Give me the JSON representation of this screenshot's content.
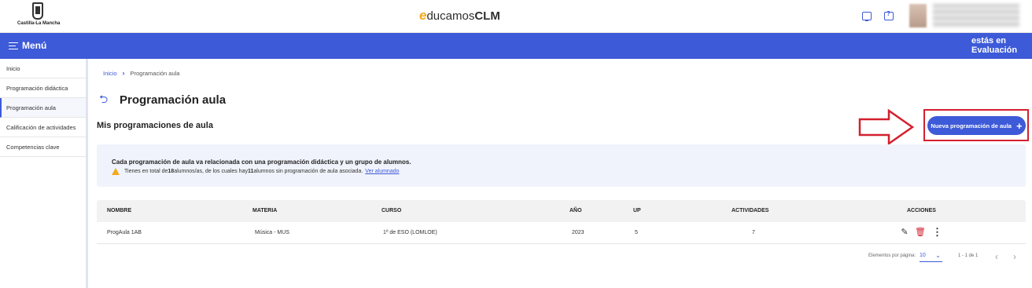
{
  "header": {
    "org_logo_text": "Castilla-La Mancha",
    "brand": {
      "e": "e",
      "ducamos": "ducamos",
      "clm": "CLM"
    },
    "icons": [
      "monitor-icon",
      "help-chat-icon"
    ]
  },
  "menubar": {
    "menu_label": "Menú",
    "context_line1": "estás en",
    "context_line2": "Evaluación"
  },
  "sidebar": {
    "items": [
      {
        "label": "Inicio",
        "active": false
      },
      {
        "label": "Programación didáctica",
        "active": false
      },
      {
        "label": "Programación aula",
        "active": true
      },
      {
        "label": "Calificación de actividades",
        "active": false
      },
      {
        "label": "Competencias clave",
        "active": false
      }
    ]
  },
  "breadcrumb": {
    "home": "Inicio",
    "current": "Programación aula"
  },
  "page": {
    "title": "Programación aula",
    "section_title": "Mis programaciones de aula",
    "new_button_label": "Nueva programación de aula"
  },
  "info": {
    "title": "Cada programación de aula va relacionada con una programación didáctica y un grupo de alumnos.",
    "line_part1": "Tienes en total de ",
    "total_students": "18",
    "line_part2": " alumnos/as, de los cuales hay ",
    "students_without": "11",
    "line_part3": " alumnos sin programación de aula asociada.",
    "link": "Ver alumnado"
  },
  "table": {
    "headers": {
      "nombre": "NOMBRE",
      "materia": "MATERIA",
      "curso": "CURSO",
      "anio": "AÑO",
      "up": "UP",
      "actividades": "ACTIVIDADES",
      "acciones": "ACCIONES"
    },
    "rows": [
      {
        "nombre": "ProgAula 1AB",
        "materia": "Música - MUS",
        "curso": "1º de ESO (LOMLOE)",
        "anio": "2023",
        "up": "5",
        "actividades": "7"
      }
    ]
  },
  "pagination": {
    "label": "Elementos por página:",
    "page_size": "10",
    "range": "1 - 1 de 1"
  },
  "colors": {
    "primary": "#3d5ad8",
    "highlight": "#d3202f",
    "warning": "#f3a91c"
  }
}
